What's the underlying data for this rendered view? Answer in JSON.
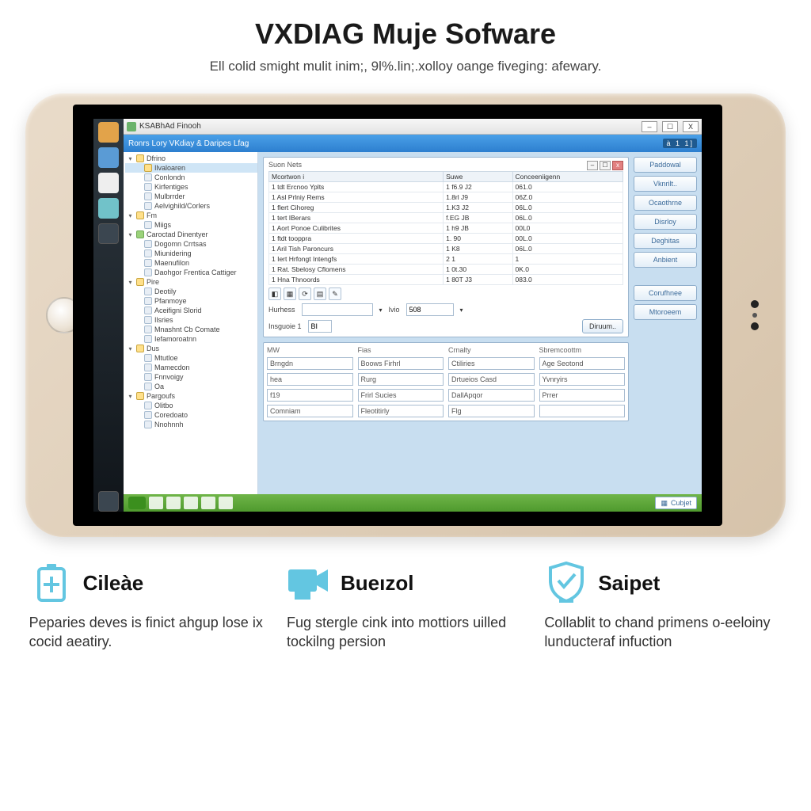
{
  "header": {
    "title": "VXDIAG Muje Sofware",
    "subtitle": "Ell colid smight mulit inim;, 9l%.lin;.xolloy oange fiveging: afewary."
  },
  "app": {
    "window_title": "KSABhAd Finooh",
    "ribbon_title": "Ronrs Lory VKdiay & Daripes Lfag",
    "ribbon_right": "à  1  1]",
    "win_min": "–",
    "win_max": "☐",
    "win_close": "X"
  },
  "tree": [
    {
      "exp": "▾",
      "icon": "ni-fold",
      "label": "Dfrino",
      "sel": false,
      "indent": 0
    },
    {
      "exp": "",
      "icon": "ni-fold",
      "label": "Ilvaloaren",
      "sel": true,
      "indent": 1
    },
    {
      "exp": "",
      "icon": "ni-page",
      "label": "Conlondn",
      "sel": false,
      "indent": 1
    },
    {
      "exp": "",
      "icon": "ni-page",
      "label": "Kirfentiges",
      "sel": false,
      "indent": 1
    },
    {
      "exp": "",
      "icon": "ni-page",
      "label": "Mulbrrder",
      "sel": false,
      "indent": 1
    },
    {
      "exp": "",
      "icon": "ni-page",
      "label": "Aelvighild/Corlers",
      "sel": false,
      "indent": 1
    },
    {
      "exp": "▾",
      "icon": "ni-fold",
      "label": "Fm",
      "sel": false,
      "indent": 0
    },
    {
      "exp": "",
      "icon": "ni-page",
      "label": "Miigs",
      "sel": false,
      "indent": 1
    },
    {
      "exp": "▾",
      "icon": "ni-green",
      "label": "Caroctad Dinentyer",
      "sel": false,
      "indent": 0
    },
    {
      "exp": "",
      "icon": "ni-page",
      "label": "Dogomn Crrtsas",
      "sel": false,
      "indent": 1
    },
    {
      "exp": "",
      "icon": "ni-page",
      "label": "Miunidering",
      "sel": false,
      "indent": 1
    },
    {
      "exp": "",
      "icon": "ni-page",
      "label": "Maenufilon",
      "sel": false,
      "indent": 1
    },
    {
      "exp": "",
      "icon": "ni-page",
      "label": "Daohgor Frentica Cattiger",
      "sel": false,
      "indent": 1
    },
    {
      "exp": "▾",
      "icon": "ni-fold",
      "label": "Pire",
      "sel": false,
      "indent": 0
    },
    {
      "exp": "",
      "icon": "ni-page",
      "label": "Deotily",
      "sel": false,
      "indent": 1
    },
    {
      "exp": "",
      "icon": "ni-page",
      "label": "Pfanmoye",
      "sel": false,
      "indent": 1
    },
    {
      "exp": "",
      "icon": "ni-page",
      "label": "Aceifigni Slorid",
      "sel": false,
      "indent": 1
    },
    {
      "exp": "",
      "icon": "ni-page",
      "label": "Ilsries",
      "sel": false,
      "indent": 1
    },
    {
      "exp": "",
      "icon": "ni-page",
      "label": "Mnashnt Cb Comate",
      "sel": false,
      "indent": 1
    },
    {
      "exp": "",
      "icon": "ni-page",
      "label": "Iefamoroatnn",
      "sel": false,
      "indent": 1
    },
    {
      "exp": "▾",
      "icon": "ni-fold",
      "label": "Dus",
      "sel": false,
      "indent": 0
    },
    {
      "exp": "",
      "icon": "ni-page",
      "label": "Mtutloe",
      "sel": false,
      "indent": 1
    },
    {
      "exp": "",
      "icon": "ni-page",
      "label": "Mamecdon",
      "sel": false,
      "indent": 1
    },
    {
      "exp": "",
      "icon": "ni-page",
      "label": "Fnnvoigy",
      "sel": false,
      "indent": 1
    },
    {
      "exp": "",
      "icon": "ni-page",
      "label": "Oa",
      "sel": false,
      "indent": 1
    },
    {
      "exp": "▾",
      "icon": "ni-fold",
      "label": "Pargoufs",
      "sel": false,
      "indent": 0
    },
    {
      "exp": "",
      "icon": "ni-page",
      "label": "Olitbo",
      "sel": false,
      "indent": 1
    },
    {
      "exp": "",
      "icon": "ni-page",
      "label": "Coredoato",
      "sel": false,
      "indent": 1
    },
    {
      "exp": "",
      "icon": "ni-page",
      "label": "Nnohnnh",
      "sel": false,
      "indent": 1
    }
  ],
  "main_panel": {
    "caption": "Suon Nets",
    "headers": [
      "Mcortwon i",
      "Suwe",
      "Conceeniigenn"
    ],
    "rows": [
      [
        "1 tdt   Ercnoo Yplts",
        "1 f6.9 J2",
        "061.0"
      ],
      [
        "1 Asl   Prlniy Rems",
        "1.8rl J9",
        "06Z.0"
      ],
      [
        "1 flert  Cihoreg",
        "1.K3 J2",
        "06L.0"
      ],
      [
        "1 tert  IBerars",
        "f.EG JB",
        "06L.0"
      ],
      [
        "1 Aort  Ponoe Culibrites",
        "1 h9 JB",
        "00L0"
      ],
      [
        "1 ftdt  tooppra",
        "1. 90",
        "00L.0"
      ],
      [
        "1 Aril  Tish Paroncurs",
        "1 K8",
        "06L.0"
      ],
      [
        "1 Iert  Hrfongt Intengfs",
        "2   1",
        "1"
      ],
      [
        "1 Rat.  Sbelosy Cflomens",
        "1 0t.30",
        "0K.0"
      ],
      [
        "1 Hna  Thnoords",
        "1 80T J3",
        "083.0"
      ]
    ]
  },
  "form": {
    "label1": "Hurhess",
    "dd_icon": "▾",
    "label2": "Ivio",
    "value2": "508",
    "label3": "Insguoie 1",
    "value3": "BI",
    "btn": "Diruum.."
  },
  "side_buttons": [
    "Paddowal",
    "Vknrilt..",
    "Ocaothrne",
    "Disrloy",
    "Deghitas",
    "Anbient",
    "Corufhnee",
    "Mtoroeem"
  ],
  "bottom": {
    "headers": [
      "MW",
      "Fias",
      "Crnalty",
      "Sbremcoottm"
    ],
    "rows": [
      [
        "Brngdn",
        "Boows Firhrl",
        "Ctiliries",
        "Age Seotond"
      ],
      [
        "hea",
        "Rurg",
        "Drtueios Casd",
        "Yvnryirs"
      ],
      [
        "f19",
        "Frirl Sucies",
        "DallApqor",
        "Prrer"
      ],
      [
        "Comniam",
        "Fleotitirly",
        "Flg",
        ""
      ]
    ]
  },
  "taskbar_btn": "Cubjet",
  "features": [
    {
      "icon": "battery",
      "title": "Cileàe",
      "desc": "Peparies deves is finict ahgup lose ix cocid aeatiry."
    },
    {
      "icon": "camera",
      "title": "Bueızol",
      "desc": "Fug stergle cink into mottiors uilled tockilng persion"
    },
    {
      "icon": "shield",
      "title": "Saipet",
      "desc": "Collablit to chand primens o-eeloiny lunducteraf infuction"
    }
  ],
  "colors": {
    "accent": "#63c6e1"
  }
}
